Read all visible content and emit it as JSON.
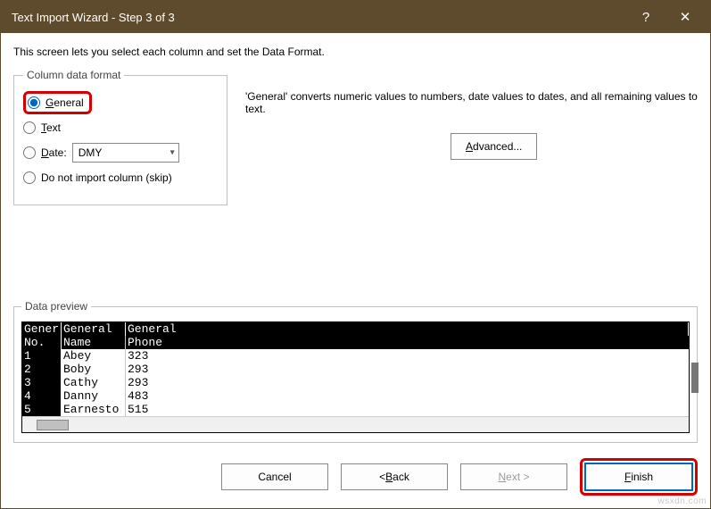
{
  "titlebar": {
    "title": "Text Import Wizard - Step 3 of 3",
    "help": "?",
    "close": "✕"
  },
  "intro": "This screen lets you select each column and set the Data Format.",
  "format": {
    "legend": "Column data format",
    "general": "General",
    "text": "Text",
    "date": "Date:",
    "date_value": "DMY",
    "skip": "Do not import column (skip)"
  },
  "description": "'General' converts numeric values to numbers, date values to dates, and all remaining values to text.",
  "advanced": "Advanced...",
  "preview": {
    "legend": "Data preview",
    "headers": [
      "Gener",
      "General",
      "General"
    ],
    "title_row": [
      "No.",
      "Name",
      "Phone"
    ],
    "rows": [
      [
        "1",
        "Abey",
        "323"
      ],
      [
        "2",
        "Boby",
        "293"
      ],
      [
        "3",
        "Cathy",
        "293"
      ],
      [
        "4",
        "Danny",
        "483"
      ],
      [
        "5",
        "Earnesto",
        "515"
      ]
    ]
  },
  "buttons": {
    "cancel": "Cancel",
    "back": "< Back",
    "next": "Next >",
    "finish": "Finish"
  },
  "watermark": "wsxdn.com"
}
